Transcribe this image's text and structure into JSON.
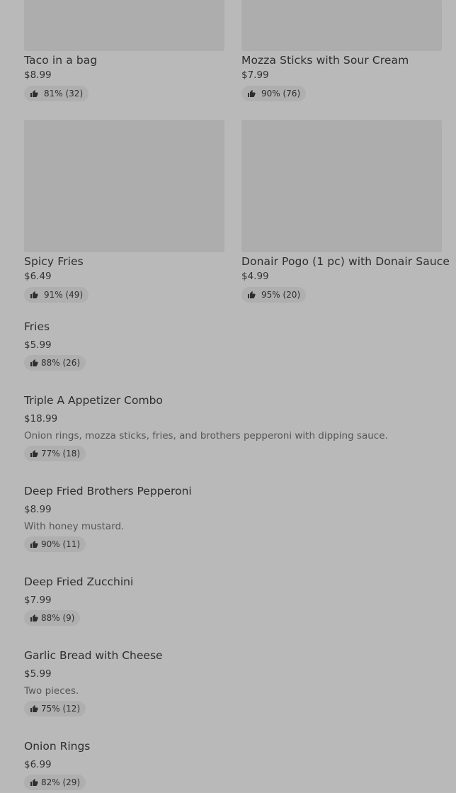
{
  "grid_items": [
    {
      "name": "Taco in a bag",
      "price": "$8.99",
      "rating": "81% (32)"
    },
    {
      "name": "Mozza Sticks with Sour Cream",
      "price": "$7.99",
      "rating": "90% (76)"
    },
    {
      "name": "Spicy Fries",
      "price": "$6.49",
      "rating": "91% (49)"
    },
    {
      "name": "Donair Pogo (1 pc) with Donair Sauce",
      "price": "$4.99",
      "rating": "95% (20)"
    }
  ],
  "list_items": [
    {
      "name": "Fries",
      "price": "$5.99",
      "description": "",
      "rating": "88% (26)"
    },
    {
      "name": "Triple A Appetizer Combo",
      "price": "$18.99",
      "description": "Onion rings, mozza sticks, fries, and brothers pepperoni with dipping sauce.",
      "rating": "77% (18)"
    },
    {
      "name": "Deep Fried Brothers Pepperoni",
      "price": "$8.99",
      "description": "With honey mustard.",
      "rating": "90% (11)"
    },
    {
      "name": "Deep Fried Zucchini",
      "price": "$7.99",
      "description": "",
      "rating": "88% (9)"
    },
    {
      "name": "Garlic Bread with Cheese",
      "price": "$5.99",
      "description": "Two pieces.",
      "rating": "75% (12)"
    },
    {
      "name": "Onion Rings",
      "price": "$6.99",
      "description": "",
      "rating": "82% (29)"
    }
  ],
  "icons": {
    "rating": "thumbs-up-icon"
  },
  "colors": {
    "background": "#b9b9b9",
    "image_placeholder": "#adadad",
    "rating_pill": "#afafaf"
  }
}
